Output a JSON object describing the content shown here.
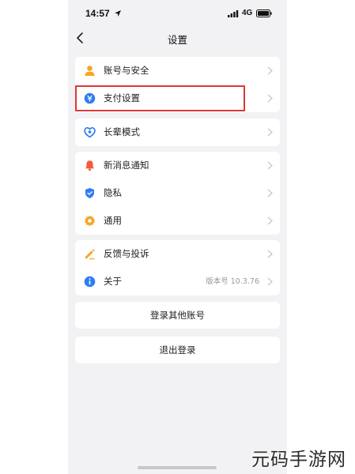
{
  "status_bar": {
    "time": "14:57",
    "network": "4G"
  },
  "nav": {
    "title": "设置"
  },
  "groups": [
    {
      "rows": [
        {
          "label": "账号与安全",
          "icon": "user-icon",
          "color": "#f5a623"
        },
        {
          "label": "支付设置",
          "icon": "payment-icon",
          "color": "#2f7cf6"
        }
      ]
    },
    {
      "rows": [
        {
          "label": "长辈模式",
          "icon": "heart-icon",
          "color": "#2f7cf6"
        }
      ]
    },
    {
      "rows": [
        {
          "label": "新消息通知",
          "icon": "bell-icon",
          "color": "#f25c3c"
        },
        {
          "label": "隐私",
          "icon": "shield-icon",
          "color": "#2f7cf6"
        },
        {
          "label": "通用",
          "icon": "gear-icon",
          "color": "#f5a623"
        }
      ]
    },
    {
      "rows": [
        {
          "label": "反馈与投诉",
          "icon": "pencil-icon",
          "color": "#f5a623"
        },
        {
          "label": "关于",
          "icon": "info-icon",
          "color": "#2f7cf6",
          "value": "版本号 10.3.76"
        }
      ]
    }
  ],
  "buttons": {
    "switch_account": "登录其他账号",
    "logout": "退出登录"
  },
  "watermark": "元码手游网",
  "colors": {
    "highlight": "#d93a37",
    "background": "#f2f2f4"
  }
}
